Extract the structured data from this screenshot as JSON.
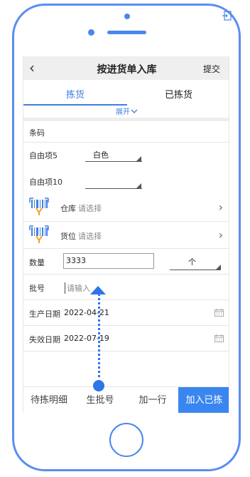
{
  "header": {
    "title": "按进货单入库",
    "back_glyph": "‹",
    "submit_label": "提交"
  },
  "tabs": [
    {
      "label": "拣货",
      "active": true
    },
    {
      "label": "已拣货",
      "active": false
    }
  ],
  "expand": {
    "label": "展开"
  },
  "form": {
    "barcode_label": "条码",
    "custom5": {
      "label": "自由项5",
      "value": "白色"
    },
    "custom10": {
      "label": "自由项10",
      "value": ""
    },
    "warehouse": {
      "label": "仓库",
      "placeholder": "请选择"
    },
    "location": {
      "label": "货位",
      "placeholder": "请选择"
    },
    "quantity": {
      "label": "数量",
      "value": "3333",
      "unit": "个"
    },
    "batch": {
      "label": "批号",
      "placeholder": "请输入"
    },
    "production_date": {
      "label": "生产日期",
      "value": "2022-04-21"
    },
    "expiry_date": {
      "label": "失效日期",
      "value": "2022-07-19"
    }
  },
  "footer": {
    "pending_label": "待拣明细",
    "gen_batch_label": "生批号",
    "add_row_label": "加一行",
    "add_picked_label": "加入已拣"
  },
  "colors": {
    "accent": "#3f7fe0",
    "frame": "#5b8df0",
    "primary_button": "#3a86f0"
  }
}
